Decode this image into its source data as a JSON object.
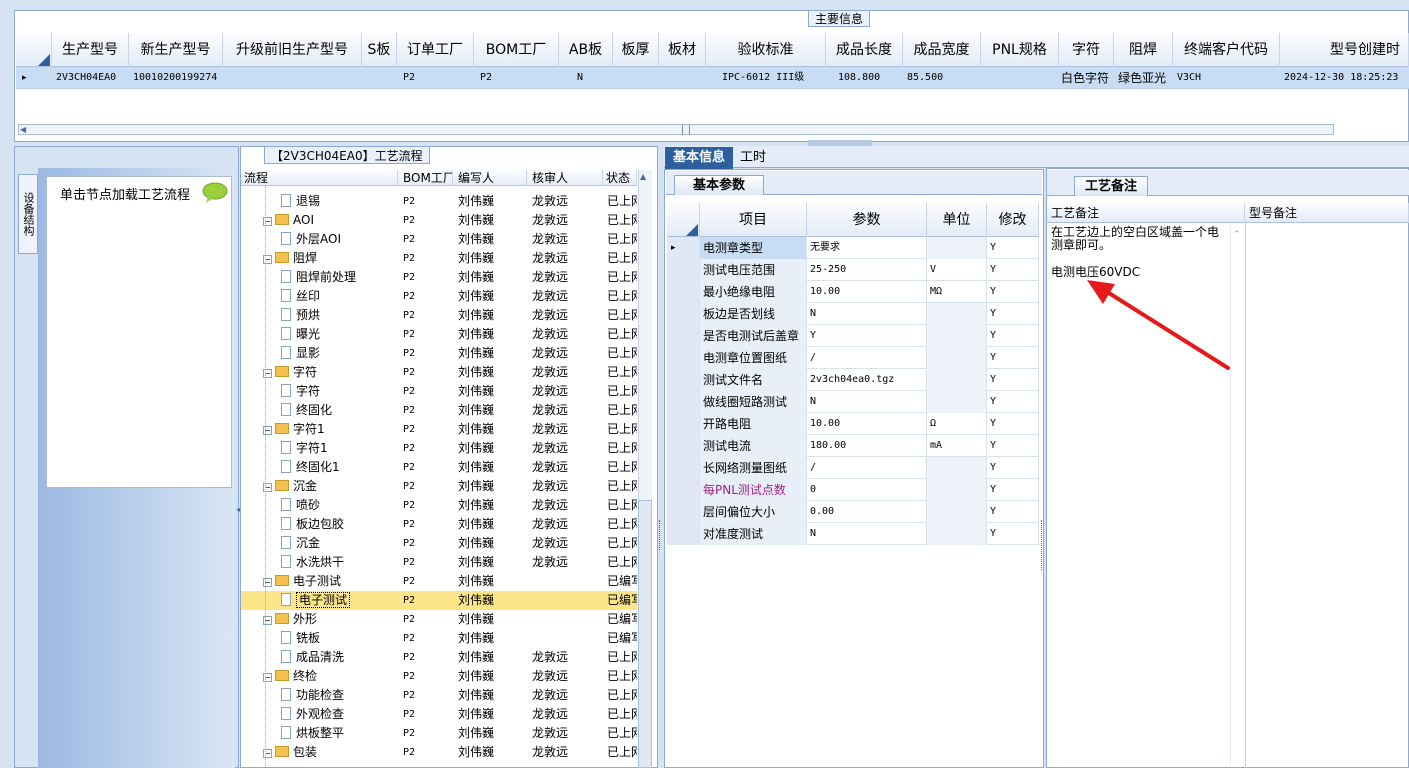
{
  "main_info": {
    "title": "主要信息",
    "columns": [
      "生产型号",
      "新生产型号",
      "升级前旧生产型号",
      "S板",
      "订单工厂",
      "BOM工厂",
      "AB板",
      "板厚",
      "板材",
      "验收标准",
      "成品长度",
      "成品宽度",
      "PNL规格",
      "字符",
      "阻焊",
      "终端客户代码",
      "型号创建时"
    ],
    "row": {
      "arrow": "▸",
      "model": "2V3CH04EA0",
      "new_model": "10010200199274",
      "old_model": "",
      "s_board": "",
      "order_factory": "P2",
      "bom_factory": "P2",
      "ab_board": "N",
      "thickness": "",
      "material": "",
      "standard": "IPC-6012 III级",
      "length": "108.800",
      "width": "85.500",
      "pnl": "",
      "char": "白色字符",
      "solder": "绿色亚光",
      "customer": "V3CH",
      "created": "2024-12-30 18:25:23"
    }
  },
  "left": {
    "vertical_tab": "设备结构",
    "hint": "单击节点加载工艺流程"
  },
  "tree": {
    "title": "【2V3CH04EA0】工艺流程",
    "columns": [
      "流程",
      "BOM工厂",
      "编写人",
      "核审人",
      "状态"
    ],
    "rows": [
      {
        "indent": 2,
        "type": "doc",
        "name": "退锡",
        "bom": "P2",
        "writer": "刘伟巍",
        "reviewer": "龙敦远",
        "status": "已上网"
      },
      {
        "indent": 1,
        "type": "folder",
        "name": "AOI",
        "bom": "P2",
        "writer": "刘伟巍",
        "reviewer": "龙敦远",
        "status": "已上网"
      },
      {
        "indent": 2,
        "type": "doc",
        "name": "外层AOI",
        "bom": "P2",
        "writer": "刘伟巍",
        "reviewer": "龙敦远",
        "status": "已上网"
      },
      {
        "indent": 1,
        "type": "folder",
        "name": "阻焊",
        "bom": "P2",
        "writer": "刘伟巍",
        "reviewer": "龙敦远",
        "status": "已上网"
      },
      {
        "indent": 2,
        "type": "doc",
        "name": "阻焊前处理",
        "bom": "P2",
        "writer": "刘伟巍",
        "reviewer": "龙敦远",
        "status": "已上网"
      },
      {
        "indent": 2,
        "type": "doc",
        "name": "丝印",
        "bom": "P2",
        "writer": "刘伟巍",
        "reviewer": "龙敦远",
        "status": "已上网"
      },
      {
        "indent": 2,
        "type": "doc",
        "name": "预烘",
        "bom": "P2",
        "writer": "刘伟巍",
        "reviewer": "龙敦远",
        "status": "已上网"
      },
      {
        "indent": 2,
        "type": "doc",
        "name": "曝光",
        "bom": "P2",
        "writer": "刘伟巍",
        "reviewer": "龙敦远",
        "status": "已上网"
      },
      {
        "indent": 2,
        "type": "doc",
        "name": "显影",
        "bom": "P2",
        "writer": "刘伟巍",
        "reviewer": "龙敦远",
        "status": "已上网"
      },
      {
        "indent": 1,
        "type": "folder",
        "name": "字符",
        "bom": "P2",
        "writer": "刘伟巍",
        "reviewer": "龙敦远",
        "status": "已上网"
      },
      {
        "indent": 2,
        "type": "doc",
        "name": "字符",
        "bom": "P2",
        "writer": "刘伟巍",
        "reviewer": "龙敦远",
        "status": "已上网"
      },
      {
        "indent": 2,
        "type": "doc",
        "name": "终固化",
        "bom": "P2",
        "writer": "刘伟巍",
        "reviewer": "龙敦远",
        "status": "已上网"
      },
      {
        "indent": 1,
        "type": "folder",
        "name": "字符1",
        "bom": "P2",
        "writer": "刘伟巍",
        "reviewer": "龙敦远",
        "status": "已上网"
      },
      {
        "indent": 2,
        "type": "doc",
        "name": "字符1",
        "bom": "P2",
        "writer": "刘伟巍",
        "reviewer": "龙敦远",
        "status": "已上网"
      },
      {
        "indent": 2,
        "type": "doc",
        "name": "终固化1",
        "bom": "P2",
        "writer": "刘伟巍",
        "reviewer": "龙敦远",
        "status": "已上网"
      },
      {
        "indent": 1,
        "type": "folder",
        "name": "沉金",
        "bom": "P2",
        "writer": "刘伟巍",
        "reviewer": "龙敦远",
        "status": "已上网"
      },
      {
        "indent": 2,
        "type": "doc",
        "name": "喷砂",
        "bom": "P2",
        "writer": "刘伟巍",
        "reviewer": "龙敦远",
        "status": "已上网"
      },
      {
        "indent": 2,
        "type": "doc",
        "name": "板边包胶",
        "bom": "P2",
        "writer": "刘伟巍",
        "reviewer": "龙敦远",
        "status": "已上网"
      },
      {
        "indent": 2,
        "type": "doc",
        "name": "沉金",
        "bom": "P2",
        "writer": "刘伟巍",
        "reviewer": "龙敦远",
        "status": "已上网"
      },
      {
        "indent": 2,
        "type": "doc",
        "name": "水洗烘干",
        "bom": "P2",
        "writer": "刘伟巍",
        "reviewer": "龙敦远",
        "status": "已上网"
      },
      {
        "indent": 1,
        "type": "folder",
        "name": "电子测试",
        "bom": "P2",
        "writer": "刘伟巍",
        "reviewer": "",
        "status": "已编写"
      },
      {
        "indent": 2,
        "type": "doc",
        "name": "电子测试",
        "bom": "P2",
        "writer": "刘伟巍",
        "reviewer": "",
        "status": "已编写",
        "selected": true
      },
      {
        "indent": 1,
        "type": "folder",
        "name": "外形",
        "bom": "P2",
        "writer": "刘伟巍",
        "reviewer": "",
        "status": "已编写"
      },
      {
        "indent": 2,
        "type": "doc",
        "name": "铣板",
        "bom": "P2",
        "writer": "刘伟巍",
        "reviewer": "",
        "status": "已编写"
      },
      {
        "indent": 2,
        "type": "doc",
        "name": "成品清洗",
        "bom": "P2",
        "writer": "刘伟巍",
        "reviewer": "龙敦远",
        "status": "已上网"
      },
      {
        "indent": 1,
        "type": "folder",
        "name": "终检",
        "bom": "P2",
        "writer": "刘伟巍",
        "reviewer": "龙敦远",
        "status": "已上网"
      },
      {
        "indent": 2,
        "type": "doc",
        "name": "功能检查",
        "bom": "P2",
        "writer": "刘伟巍",
        "reviewer": "龙敦远",
        "status": "已上网"
      },
      {
        "indent": 2,
        "type": "doc",
        "name": "外观检查",
        "bom": "P2",
        "writer": "刘伟巍",
        "reviewer": "龙敦远",
        "status": "已上网"
      },
      {
        "indent": 2,
        "type": "doc",
        "name": "烘板整平",
        "bom": "P2",
        "writer": "刘伟巍",
        "reviewer": "龙敦远",
        "status": "已上网"
      },
      {
        "indent": 1,
        "type": "folder",
        "name": "包装",
        "bom": "P2",
        "writer": "刘伟巍",
        "reviewer": "龙敦远",
        "status": "已上网"
      }
    ]
  },
  "basic_info": {
    "tabs": [
      "基本信息",
      "工时"
    ],
    "subtab": "基本参数",
    "columns": [
      "项目",
      "参数",
      "单位",
      "修改"
    ],
    "rows": [
      {
        "item": "电测章类型",
        "param": "无要求",
        "unit": "",
        "mod": "Y",
        "current": true
      },
      {
        "item": "测试电压范围",
        "param": "25-250",
        "unit": "V",
        "mod": "Y"
      },
      {
        "item": "最小绝缘电阻",
        "param": "10.00",
        "unit": "MΩ",
        "mod": "Y"
      },
      {
        "item": "板边是否划线",
        "param": "N",
        "unit": "",
        "mod": "Y"
      },
      {
        "item": "是否电测试后盖章",
        "param": "Y",
        "unit": "",
        "mod": "Y"
      },
      {
        "item": "电测章位置图纸",
        "param": "/",
        "unit": "",
        "mod": "Y"
      },
      {
        "item": "测试文件名",
        "param": "2v3ch04ea0.tgz",
        "unit": "",
        "mod": "Y"
      },
      {
        "item": "做线圈短路测试",
        "param": "N",
        "unit": "",
        "mod": "Y"
      },
      {
        "item": "开路电阻",
        "param": "10.00",
        "unit": "Ω",
        "mod": "Y"
      },
      {
        "item": "测试电流",
        "param": "180.00",
        "unit": "mA",
        "mod": "Y"
      },
      {
        "item": "长网络测量图纸",
        "param": "/",
        "unit": "",
        "mod": "Y"
      },
      {
        "item": "每PNL测试点数",
        "param": "0",
        "unit": "",
        "mod": "Y",
        "highlight": true
      },
      {
        "item": "层间偏位大小",
        "param": "0.00",
        "unit": "",
        "mod": "Y"
      },
      {
        "item": "对准度测试",
        "param": "N",
        "unit": "",
        "mod": "Y"
      }
    ]
  },
  "notes": {
    "tab": "工艺备注",
    "col1": "工艺备注",
    "col2": "型号备注",
    "text": "在工艺边上的空白区域盖一个电测章即可。",
    "text2": "电测电压60VDC",
    "arrow_color": "#e8191b"
  }
}
